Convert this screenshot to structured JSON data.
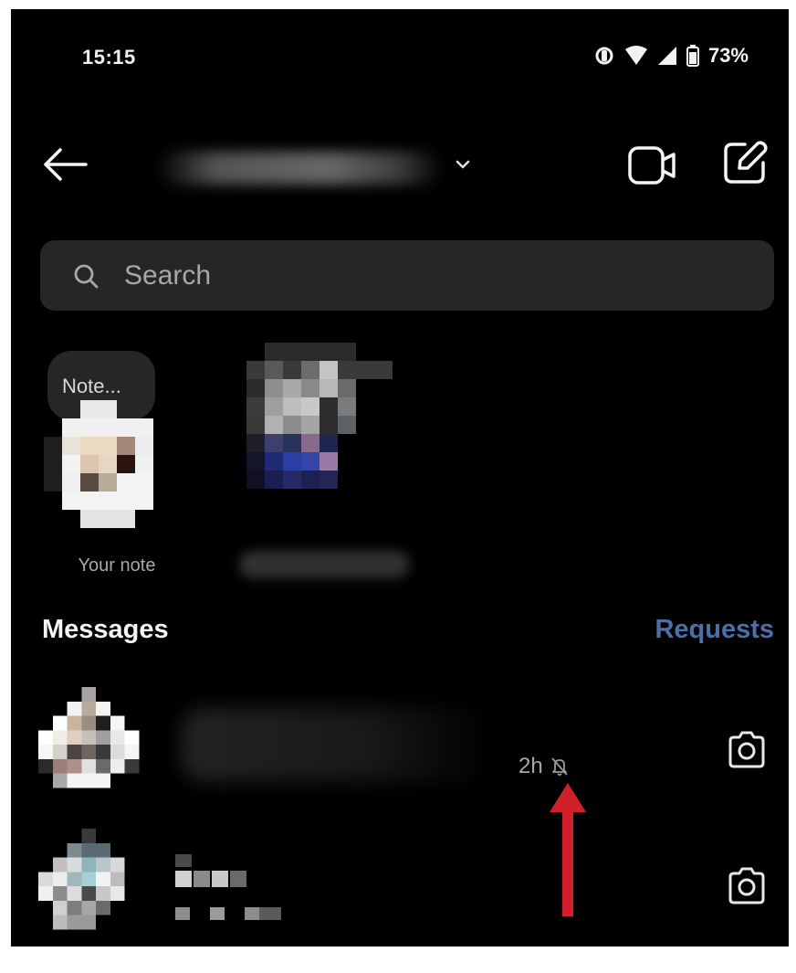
{
  "status_bar": {
    "time": "15:15",
    "battery": "73%",
    "icons": [
      "vibrate-icon",
      "wifi-icon",
      "signal-icon",
      "battery-icon"
    ]
  },
  "header": {
    "icons": [
      "back-arrow-icon",
      "chevron-down-icon",
      "video-call-icon",
      "compose-icon"
    ]
  },
  "search": {
    "placeholder": "Search",
    "icon": "search-icon"
  },
  "notes": {
    "your_note_bubble": "Note...",
    "your_note_caption": "Your note"
  },
  "messages": {
    "heading": "Messages",
    "requests_label": "Requests",
    "conversations": [
      {
        "time": "2h",
        "muted": true,
        "action_icon": "camera-icon"
      },
      {
        "time": "",
        "muted": false,
        "action_icon": "camera-icon"
      }
    ]
  },
  "colors": {
    "background": "#000000",
    "search_background": "#262626",
    "requests_link": "#4c6fa8",
    "secondary_text": "#a8a8a8",
    "annotation_arrow": "#d0202a"
  }
}
